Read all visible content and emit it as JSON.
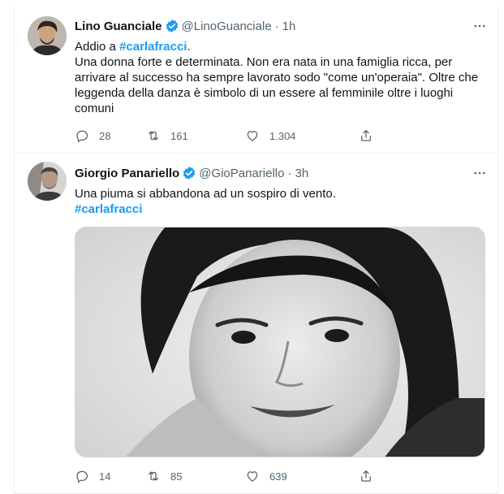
{
  "tweets": [
    {
      "author": "Lino Guanciale",
      "handle": "@LinoGuanciale",
      "separator": "·",
      "time": "1h",
      "text_prefix": "Addio a ",
      "hashtag": "#carlafracci",
      "text_suffix": ".",
      "text_body": "Una donna forte e determinata. Non era nata in una famiglia ricca, per arrivare al successo ha sempre lavorato sodo \"come un'operaia\". Oltre che leggenda della danza è simbolo di un essere al femminile oltre i luoghi comuni",
      "replies": "28",
      "retweets": "161",
      "likes": "1.304"
    },
    {
      "author": "Giorgio Panariello",
      "handle": "@GioPanariello",
      "separator": "·",
      "time": "3h",
      "text_body": "Una piuma si abbandona ad un sospiro di vento.",
      "hashtag": "#carlafracci",
      "replies": "14",
      "retweets": "85",
      "likes": "639"
    }
  ],
  "icons": {
    "verified": "verified-badge-icon",
    "more": "more-options-icon",
    "reply": "reply-icon",
    "retweet": "retweet-icon",
    "like": "heart-icon",
    "share": "share-icon"
  },
  "colors": {
    "accent": "#1d9bf0",
    "text": "#0f1419",
    "muted": "#536471"
  }
}
